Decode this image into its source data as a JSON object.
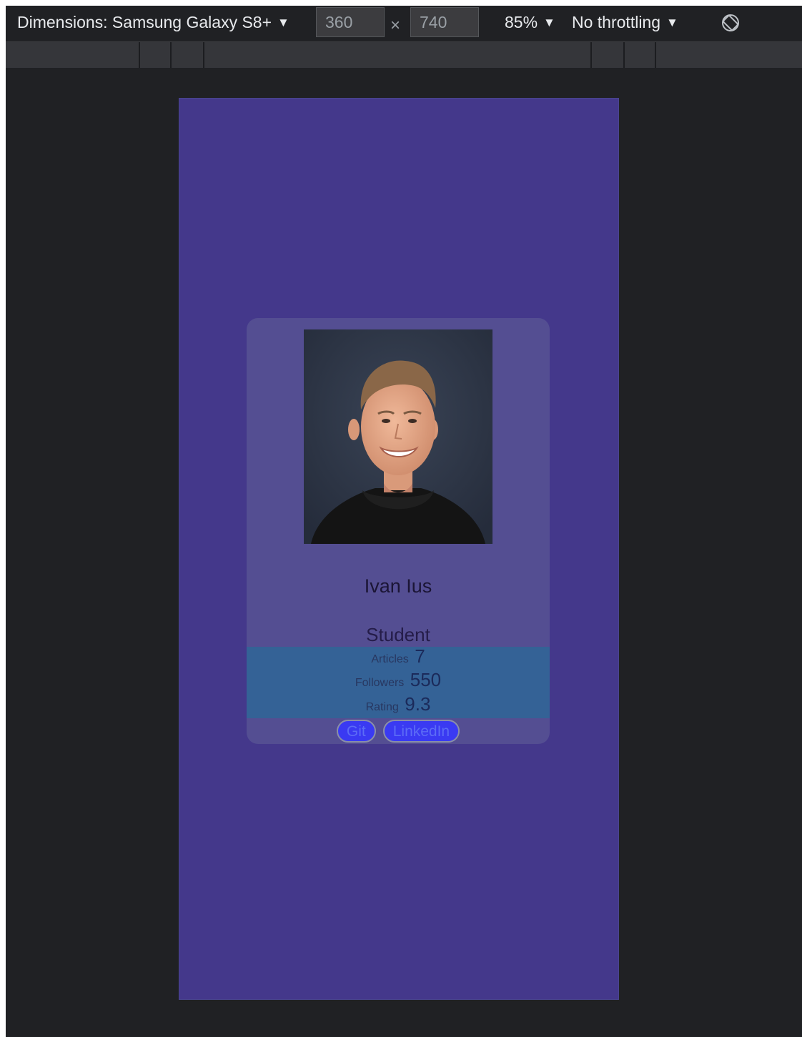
{
  "toolbar": {
    "dimensions_label": "Dimensions: Samsung Galaxy S8+",
    "width_value": "360",
    "times_symbol": "×",
    "height_value": "740",
    "zoom_label": "85%",
    "throttling_label": "No throttling"
  },
  "profile": {
    "name": "Ivan Ius",
    "role": "Student",
    "stats": [
      {
        "label": "Articles",
        "value": "7"
      },
      {
        "label": "Followers",
        "value": "550"
      },
      {
        "label": "Rating",
        "value": "9.3"
      }
    ],
    "buttons": {
      "git": "Git",
      "linkedin": "LinkedIn"
    }
  },
  "colors": {
    "devtools_bg": "#202124",
    "viewport_bg": "#44388b",
    "card_bg": "#544e92",
    "stats_bg": "#346296",
    "button_bg": "#3a3af2"
  }
}
